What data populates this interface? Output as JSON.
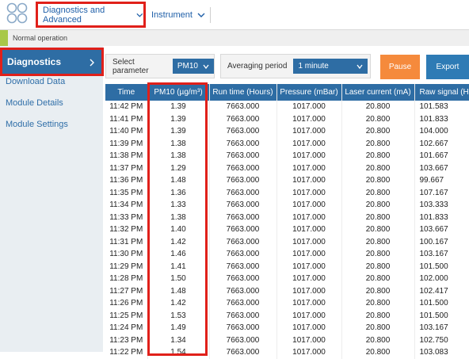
{
  "header": {
    "nav_primary": "Diagnostics and Advanced",
    "nav_secondary": "Instrument"
  },
  "status": {
    "text": "Normal operation"
  },
  "sidebar": {
    "items": [
      {
        "label": "Diagnostics",
        "active": true
      },
      {
        "label": "Download Data"
      },
      {
        "label": "Module Details"
      },
      {
        "label": "Module Settings"
      }
    ]
  },
  "controls": {
    "parameter_label": "Select parameter",
    "parameter_value": "PM10",
    "averaging_label": "Averaging period",
    "averaging_value": "1 minute",
    "pause_label": "Pause",
    "export_label": "Export"
  },
  "table": {
    "headers": [
      "Time",
      "PM10 (µg/m³)",
      "Run time (Hours)",
      "Pressure (mBar)",
      "Laser current (mA)",
      "Raw signal (Hz)"
    ],
    "rows": [
      [
        "11:42 PM",
        "1.39",
        "7663.000",
        "1017.000",
        "20.800",
        "101.583"
      ],
      [
        "11:41 PM",
        "1.39",
        "7663.000",
        "1017.000",
        "20.800",
        "101.833"
      ],
      [
        "11:40 PM",
        "1.39",
        "7663.000",
        "1017.000",
        "20.800",
        "104.000"
      ],
      [
        "11:39 PM",
        "1.38",
        "7663.000",
        "1017.000",
        "20.800",
        "102.667"
      ],
      [
        "11:38 PM",
        "1.38",
        "7663.000",
        "1017.000",
        "20.800",
        "101.667"
      ],
      [
        "11:37 PM",
        "1.29",
        "7663.000",
        "1017.000",
        "20.800",
        "103.667"
      ],
      [
        "11:36 PM",
        "1.48",
        "7663.000",
        "1017.000",
        "20.800",
        "99.667"
      ],
      [
        "11:35 PM",
        "1.36",
        "7663.000",
        "1017.000",
        "20.800",
        "107.167"
      ],
      [
        "11:34 PM",
        "1.33",
        "7663.000",
        "1017.000",
        "20.800",
        "103.333"
      ],
      [
        "11:33 PM",
        "1.38",
        "7663.000",
        "1017.000",
        "20.800",
        "101.833"
      ],
      [
        "11:32 PM",
        "1.40",
        "7663.000",
        "1017.000",
        "20.800",
        "103.667"
      ],
      [
        "11:31 PM",
        "1.42",
        "7663.000",
        "1017.000",
        "20.800",
        "100.167"
      ],
      [
        "11:30 PM",
        "1.46",
        "7663.000",
        "1017.000",
        "20.800",
        "103.167"
      ],
      [
        "11:29 PM",
        "1.41",
        "7663.000",
        "1017.000",
        "20.800",
        "101.500"
      ],
      [
        "11:28 PM",
        "1.50",
        "7663.000",
        "1017.000",
        "20.800",
        "102.000"
      ],
      [
        "11:27 PM",
        "1.48",
        "7663.000",
        "1017.000",
        "20.800",
        "102.417"
      ],
      [
        "11:26 PM",
        "1.42",
        "7663.000",
        "1017.000",
        "20.800",
        "101.500"
      ],
      [
        "11:25 PM",
        "1.53",
        "7663.000",
        "1017.000",
        "20.800",
        "101.500"
      ],
      [
        "11:24 PM",
        "1.49",
        "7663.000",
        "1017.000",
        "20.800",
        "103.167"
      ],
      [
        "11:23 PM",
        "1.34",
        "7663.000",
        "1017.000",
        "20.800",
        "102.750"
      ],
      [
        "11:22 PM",
        "1.54",
        "7663.000",
        "1017.000",
        "20.800",
        "103.083"
      ]
    ]
  },
  "colors": {
    "primary_blue": "#2e6da4",
    "highlight_red": "#e0201a",
    "pause_orange": "#f58a3c",
    "status_green": "#a8c848"
  }
}
